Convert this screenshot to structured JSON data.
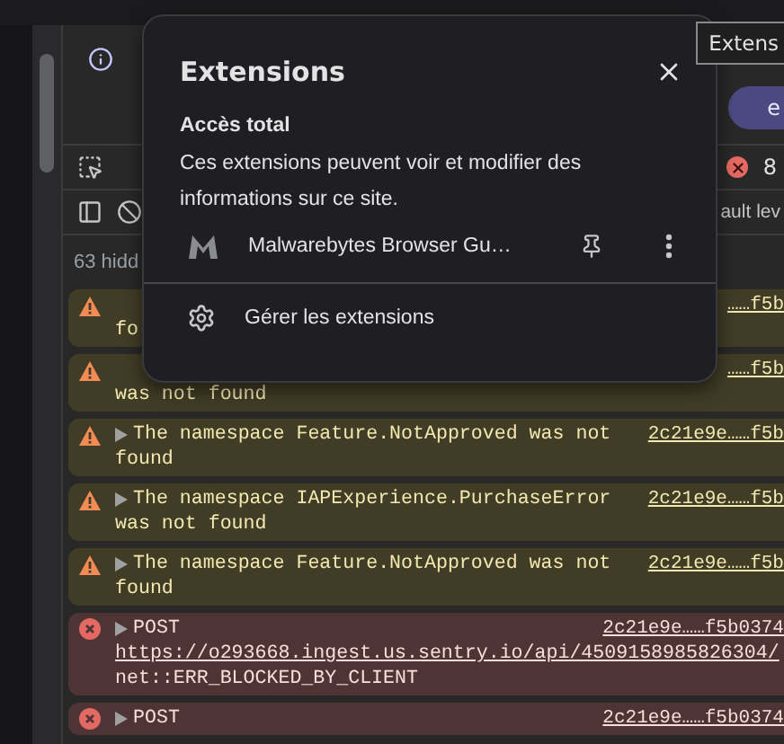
{
  "tooltip": "Extens",
  "toolbar": {
    "pill": "e",
    "error_count": "8",
    "filter_label": "ault lev",
    "hidden_label": "63 hidd"
  },
  "popup": {
    "title": "Extensions",
    "section_title": "Accès total",
    "section_text": "Ces extensions peuvent voir et modifier des informations sur ce site.",
    "extensions": [
      {
        "name": "Malwarebytes Browser Gu…"
      }
    ],
    "manage": "Gérer les extensions"
  },
  "messages": [
    {
      "kind": "warning",
      "link": "……f5b",
      "lines": [
        "fo"
      ]
    },
    {
      "kind": "warning",
      "link": "……f5b",
      "lines": [
        "was not found"
      ]
    },
    {
      "kind": "warning",
      "head": "The namespace Feature.NotApproved was not",
      "link": "2c21e9e……f5b",
      "lines": [
        "found"
      ]
    },
    {
      "kind": "warning",
      "head": "The namespace IAPExperience.PurchaseError",
      "link": "2c21e9e……f5b",
      "lines": [
        "was not found"
      ]
    },
    {
      "kind": "warning",
      "head": "The namespace Feature.NotApproved was not",
      "link": "2c21e9e……f5b",
      "lines": [
        "found"
      ]
    },
    {
      "kind": "error",
      "head": "POST",
      "link": "2c21e9e……f5b0374",
      "url": "https://o293668.ingest.us.sentry.io/api/4509158985826304/",
      "lines": [
        "net::ERR_BLOCKED_BY_CLIENT"
      ]
    },
    {
      "kind": "error",
      "head": "POST",
      "link": "2c21e9e……f5b0374"
    }
  ]
}
